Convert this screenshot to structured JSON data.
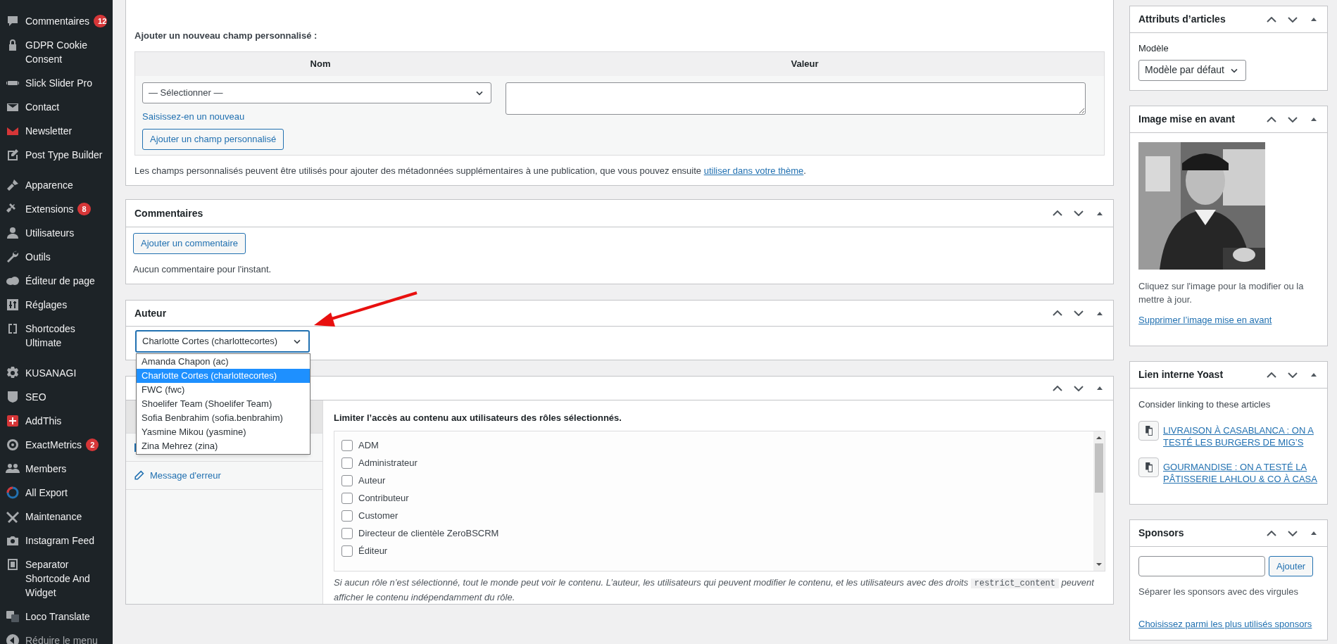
{
  "sidebar": {
    "groups": [
      [
        {
          "label": "Commentaires",
          "badge": "12"
        },
        {
          "label": "GDPR Cookie Consent"
        },
        {
          "label": "Slick Slider Pro"
        },
        {
          "label": "Contact"
        },
        {
          "label": "Newsletter"
        },
        {
          "label": "Post Type Builder"
        }
      ],
      [
        {
          "label": "Apparence"
        },
        {
          "label": "Extensions",
          "badge": "8"
        },
        {
          "label": "Utilisateurs"
        },
        {
          "label": "Outils"
        },
        {
          "label": "Éditeur de page"
        },
        {
          "label": "Réglages"
        },
        {
          "label": "Shortcodes Ultimate"
        }
      ],
      [
        {
          "label": "KUSANAGI"
        },
        {
          "label": "SEO"
        },
        {
          "label": "AddThis"
        },
        {
          "label": "ExactMetrics",
          "badge": "2"
        },
        {
          "label": "Members"
        },
        {
          "label": "All Export"
        },
        {
          "label": "Maintenance"
        },
        {
          "label": "Instagram Feed"
        },
        {
          "label": "Separator Shortcode And Widget"
        },
        {
          "label": "Loco Translate"
        }
      ]
    ],
    "collapse": "Réduire le menu"
  },
  "custom_fields": {
    "heading": "Ajouter un nouveau champ personnalisé :",
    "columns": [
      "Nom",
      "Valeur"
    ],
    "select": "— Sélectionner —",
    "enter_new": "Saisissez-en un nouveau",
    "add_button": "Ajouter un champ personnalisé",
    "note": "Les champs personnalisés peuvent être utilisés pour ajouter des métadonnées supplémentaires à une publication, que vous pouvez ensuite ",
    "note_link": "utiliser dans votre thème",
    "note_end": "."
  },
  "comments": {
    "title": "Commentaires",
    "button": "Ajouter un commentaire",
    "empty": "Aucun commentaire pour l'instant."
  },
  "author": {
    "title": "Auteur",
    "value": "Charlotte Cortes (charlottecortes)",
    "options": [
      {
        "label": "Amanda Chapon (ac)",
        "selected": false
      },
      {
        "label": "Charlotte Cortes (charlottecortes)",
        "selected": true
      },
      {
        "label": "FWC (fwc)",
        "selected": false
      },
      {
        "label": "Shoelifer Team (Shoelifer Team)",
        "selected": false
      },
      {
        "label": "Sofia Benbrahim (sofia.benbrahim)",
        "selected": false
      },
      {
        "label": "Yasmine Mikou (yasmine)",
        "selected": false
      },
      {
        "label": "Zina Mehrez (zina)",
        "selected": false
      }
    ]
  },
  "restrict": {
    "tabs": [
      {
        "selected": true
      },
      {
        "selected": false
      },
      {
        "label": "Message d'erreur",
        "selected": false
      }
    ],
    "heading": "Limiter l’accès au contenu aux utilisateurs des rôles sélectionnés.",
    "roles": [
      {
        "label": "ADM",
        "checked": false
      },
      {
        "label": "Administrateur",
        "checked": false
      },
      {
        "label": "Auteur",
        "checked": false
      },
      {
        "label": "Contributeur",
        "checked": false
      },
      {
        "label": "Customer",
        "checked": false
      },
      {
        "label": "Directeur de clientèle ZeroBSCRM",
        "checked": false
      },
      {
        "label": "Éditeur",
        "checked": false
      }
    ],
    "note": "Si aucun rôle n’est sélectionné, tout le monde peut voir le contenu. L’auteur, les utilisateurs qui peuvent modifier le contenu, et les utilisateurs avec des droits ",
    "note_code": "restrict_content",
    "note_end": " peuvent afficher le contenu indépendamment du rôle."
  },
  "post_attributes": {
    "title": "Attributs d’articles",
    "label": "Modèle",
    "select": "Modèle par défaut"
  },
  "featured_image": {
    "title": "Image mise en avant",
    "kind": "picture",
    "caption": "Cliquez sur l'image pour la modifier ou la mettre à jour.",
    "remove_link": "Supprimer l’image mise en avant"
  },
  "yoast": {
    "title": "Lien interne Yoast",
    "intro": "Consider linking to these articles",
    "links": [
      "LIVRAISON À CASABLANCA : ON A TESTÉ LES BURGERS DE MIG’S",
      "GOURMANDISE : ON A TESTÉ LA PÂTISSERIE LAHLOU & CO À CASA"
    ]
  },
  "sponsors": {
    "title": "Sponsors",
    "button": "Ajouter",
    "hint": "Séparer les sponsors avec des virgules",
    "link": "Choisissez parmi les plus utilisés sponsors"
  }
}
